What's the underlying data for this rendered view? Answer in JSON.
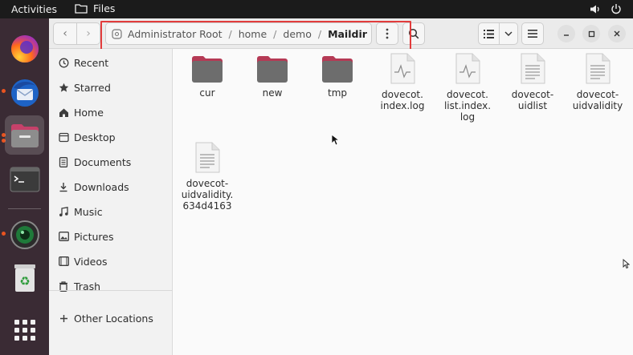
{
  "topbar": {
    "activities": "Activities",
    "app_name": "Files",
    "icons": [
      "folder-icon",
      "volume-icon",
      "power-icon"
    ]
  },
  "dock": {
    "items": [
      {
        "name": "firefox",
        "icon": "firefox-icon"
      },
      {
        "name": "thunderbird",
        "icon": "thunderbird-icon"
      },
      {
        "name": "files",
        "icon": "files-icon",
        "active": true
      },
      {
        "name": "terminal",
        "icon": "terminal-icon"
      },
      {
        "name": "cheese",
        "icon": "camera-icon"
      },
      {
        "name": "trash",
        "icon": "trash-icon"
      },
      {
        "name": "show-apps",
        "icon": "app-grid-icon"
      }
    ]
  },
  "headerbar": {
    "back_icon": "chevron-left-icon",
    "forward_icon": "chevron-right-icon",
    "path": {
      "root": "Administrator Root",
      "segments": [
        "home",
        "demo"
      ],
      "current": "Maildir"
    },
    "menu_icon": "kebab-menu-icon",
    "search_icon": "search-icon",
    "view_icon": "list-view-icon",
    "sort_icon": "chevron-down-icon",
    "hamburger_icon": "hamburger-icon",
    "window_controls": [
      "minimize-icon",
      "maximize-icon",
      "close-icon"
    ]
  },
  "sidebar": {
    "items": [
      {
        "label": "Recent",
        "icon": "clock-icon"
      },
      {
        "label": "Starred",
        "icon": "star-icon"
      },
      {
        "label": "Home",
        "icon": "home-icon"
      },
      {
        "label": "Desktop",
        "icon": "desktop-icon"
      },
      {
        "label": "Documents",
        "icon": "document-icon"
      },
      {
        "label": "Downloads",
        "icon": "download-icon"
      },
      {
        "label": "Music",
        "icon": "music-icon"
      },
      {
        "label": "Pictures",
        "icon": "picture-icon"
      },
      {
        "label": "Videos",
        "icon": "video-icon"
      },
      {
        "label": "Trash",
        "icon": "trash-icon"
      }
    ],
    "other": {
      "label": "Other Locations",
      "icon": "plus-icon"
    }
  },
  "files": [
    {
      "name": "cur",
      "type": "folder"
    },
    {
      "name": "new",
      "type": "folder"
    },
    {
      "name": "tmp",
      "type": "folder"
    },
    {
      "name": "dovecot.\nindex.log",
      "type": "log"
    },
    {
      "name": "dovecot.\nlist.index.\nlog",
      "type": "log"
    },
    {
      "name": "dovecot-\nuidlist",
      "type": "text"
    },
    {
      "name": "dovecot-\nuidvalidity",
      "type": "text"
    },
    {
      "name": "dovecot-\nuidvalidity.\n634d4163",
      "type": "text"
    }
  ],
  "colors": {
    "highlight_border": "#e23c3c",
    "folder_body": "#6d6d6d",
    "folder_tab": "#b53a55",
    "dock_bg": "#3a2b34",
    "accent": "#e95420"
  }
}
